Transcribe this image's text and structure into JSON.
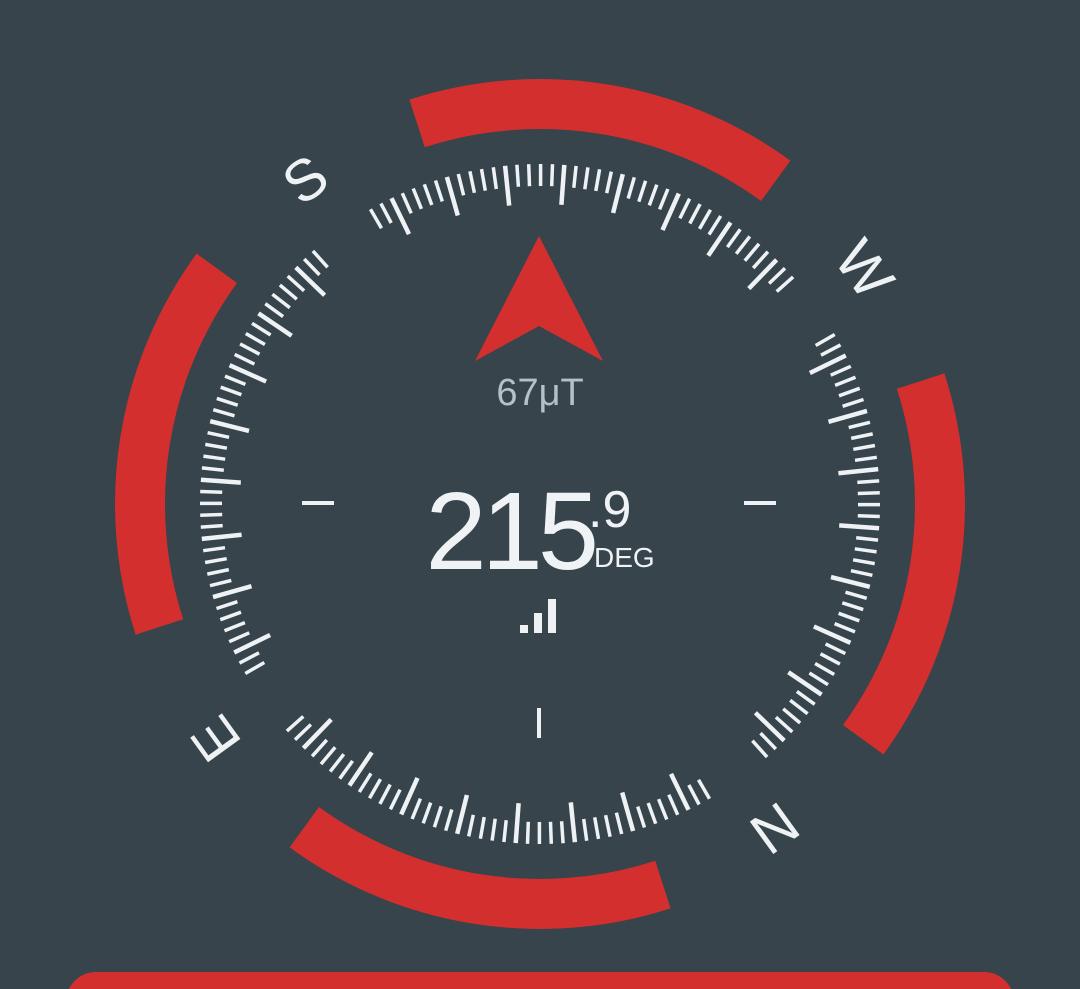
{
  "compass": {
    "cardinals": {
      "south": "S",
      "west": "W",
      "north": "N",
      "east": "E"
    },
    "heading_degrees": 215.9,
    "heading_integer": "215",
    "heading_decimal": ".9",
    "heading_unit": "DEG",
    "field_strength": "67μT",
    "accuracy_level": 3,
    "accuracy_max": 3
  },
  "colors": {
    "background": "#37444b",
    "accent": "#d32f2f",
    "ticks": "#eef2f4",
    "muted_text": "#b7c0c5"
  },
  "icons": {
    "heading_pointer": "north-arrow-icon",
    "accuracy": "signal-bars-icon"
  }
}
